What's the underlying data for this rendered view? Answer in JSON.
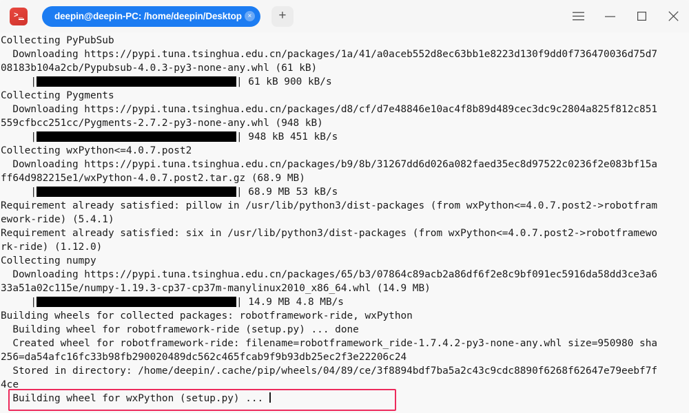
{
  "window": {
    "app_icon_name": "terminal-icon",
    "tab": {
      "title": "deepin@deepin-PC: /home/deepin/Desktop",
      "close_label": "×"
    },
    "new_tab_label": "+",
    "controls": {
      "menu": "☰",
      "minimize": "—",
      "maximize": "□",
      "close": "✕"
    }
  },
  "colors": {
    "tab_active": "#1c7cf2",
    "terminal_bg": "#f8f8f8",
    "terminal_fg": "#1a1a1a",
    "highlight_border": "#ed2a5b",
    "app_icon": "#e8483f"
  },
  "terminal": {
    "lines": [
      {
        "text": "Collecting PyPubSub"
      },
      {
        "text": "  Downloading https://pypi.tuna.tsinghua.edu.cn/packages/1a/41/a0aceb552d8ec63bb1e8223d130f9dd0f736470036d75d7"
      },
      {
        "text": "08183b104a2cb/Pypubsub-4.0.3-py3-none-any.whl (61 kB)"
      },
      {
        "pre": "     |",
        "bar": 290,
        "post": "| 61 kB 900 kB/s"
      },
      {
        "text": "Collecting Pygments"
      },
      {
        "text": "  Downloading https://pypi.tuna.tsinghua.edu.cn/packages/d8/cf/d7e48846e10ac4f8b89d489cec3dc9c2804a825f812c851"
      },
      {
        "text": "559cfbcc251cc/Pygments-2.7.2-py3-none-any.whl (948 kB)"
      },
      {
        "pre": "     |",
        "bar": 290,
        "post": "| 948 kB 451 kB/s"
      },
      {
        "text": "Collecting wxPython<=4.0.7.post2"
      },
      {
        "text": "  Downloading https://pypi.tuna.tsinghua.edu.cn/packages/b9/8b/31267dd6d026a082faed35ec8d97522c0236f2e083bf15a"
      },
      {
        "text": "ff64d982215e1/wxPython-4.0.7.post2.tar.gz (68.9 MB)"
      },
      {
        "pre": "     |",
        "bar": 290,
        "post": "| 68.9 MB 53 kB/s"
      },
      {
        "text": "Requirement already satisfied: pillow in /usr/lib/python3/dist-packages (from wxPython<=4.0.7.post2->robotfram"
      },
      {
        "text": "ework-ride) (5.4.1)"
      },
      {
        "text": "Requirement already satisfied: six in /usr/lib/python3/dist-packages (from wxPython<=4.0.7.post2->robotframewo"
      },
      {
        "text": "rk-ride) (1.12.0)"
      },
      {
        "text": "Collecting numpy"
      },
      {
        "text": "  Downloading https://pypi.tuna.tsinghua.edu.cn/packages/65/b3/07864c89acb2a86df6f2e8c9bf091ec5916da58dd3ce3a6"
      },
      {
        "text": "33a51a02c115e/numpy-1.19.3-cp37-cp37m-manylinux2010_x86_64.whl (14.9 MB)"
      },
      {
        "pre": "     |",
        "bar": 290,
        "post": "| 14.9 MB 4.8 MB/s"
      },
      {
        "text": "Building wheels for collected packages: robotframework-ride, wxPython"
      },
      {
        "text": "  Building wheel for robotframework-ride (setup.py) ... done"
      },
      {
        "text": "  Created wheel for robotframework-ride: filename=robotframework_ride-1.7.4.2-py3-none-any.whl size=950980 sha"
      },
      {
        "text": "256=da54afc16fc33b98fb290020489dc562c465fcab9f9b93db25ec2f3e22206c24"
      },
      {
        "text": "  Stored in directory: /home/deepin/.cache/pip/wheels/04/89/ce/3f8894bdf7ba5a2c43c9cdc8890f6268f62647e79eebf7f"
      },
      {
        "text": "4ce"
      },
      {
        "text": "  Building wheel for wxPython (setup.py) ... ",
        "cursor": true,
        "highlighted": true
      }
    ]
  }
}
